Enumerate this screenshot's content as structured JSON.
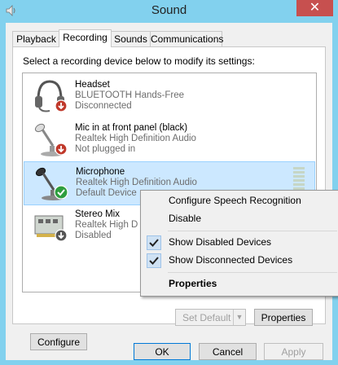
{
  "window": {
    "title": "Sound",
    "close_glyph": "✕"
  },
  "tabs": [
    "Playback",
    "Recording",
    "Sounds",
    "Communications"
  ],
  "active_tab": "Recording",
  "prompt": "Select a recording device below to modify its settings:",
  "devices": [
    {
      "name": "Headset",
      "line2": "BLUETOOTH Hands-Free",
      "status": "Disconnected",
      "icon": "headset-icon",
      "badge": "red-down-arrow"
    },
    {
      "name": "Mic in at front panel (black)",
      "line2": "Realtek High Definition Audio",
      "status": "Not plugged in",
      "icon": "microphone-icon",
      "badge": "red-down-arrow"
    },
    {
      "name": "Microphone",
      "line2": "Realtek High Definition Audio",
      "status": "Default Device",
      "icon": "microphone-icon",
      "badge": "green-check",
      "selected": true
    },
    {
      "name": "Stereo Mix",
      "line2": "Realtek High D",
      "status": "Disabled",
      "icon": "soundcard-icon",
      "badge": "down-arrow"
    }
  ],
  "context_menu": {
    "items": [
      {
        "label": "Configure Speech Recognition",
        "checked": false
      },
      {
        "label": "Disable",
        "checked": false
      },
      {
        "label": "Show Disabled Devices",
        "checked": true
      },
      {
        "label": "Show Disconnected Devices",
        "checked": true
      },
      {
        "label": "Properties",
        "checked": false,
        "bold": true
      }
    ]
  },
  "buttons": {
    "configure": "Configure",
    "set_default": "Set Default",
    "properties": "Properties",
    "ok": "OK",
    "cancel": "Cancel",
    "apply": "Apply"
  },
  "colors": {
    "titlebar": "#82d1ee",
    "close": "#c7504f",
    "selection": "#cce8ff",
    "selection_border": "#99d1ff"
  }
}
